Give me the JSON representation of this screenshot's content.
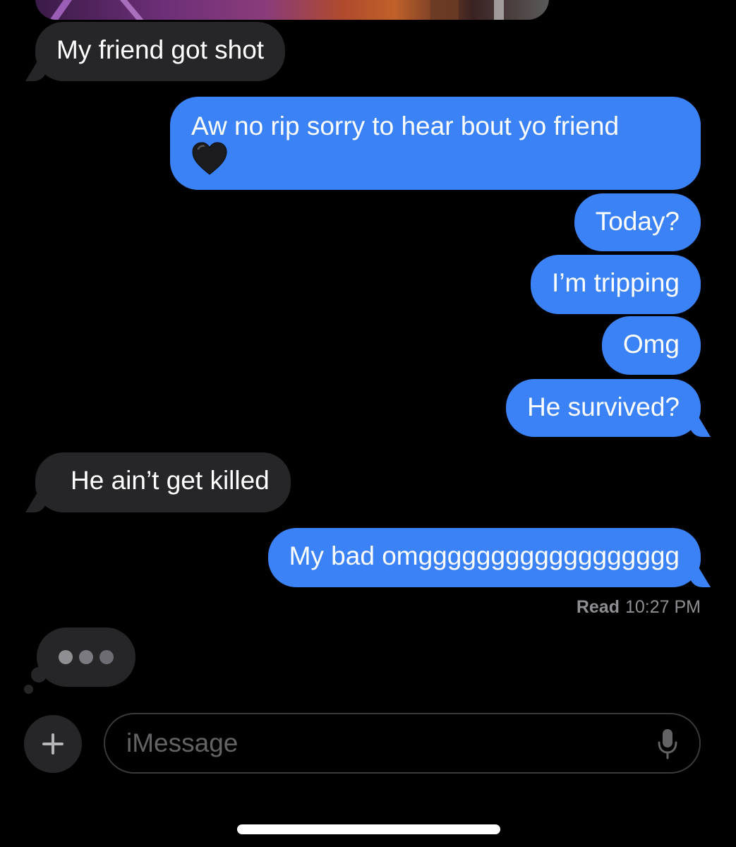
{
  "messages": [
    {
      "direction": "received",
      "text": "My friend got shot"
    },
    {
      "direction": "sent",
      "text": "Aw no rip sorry to hear bout yo friend",
      "emoji": "🖤"
    },
    {
      "direction": "sent",
      "text": "Today?"
    },
    {
      "direction": "sent",
      "text": "I’m tripping"
    },
    {
      "direction": "sent",
      "text": "Omg"
    },
    {
      "direction": "sent",
      "text": "He survived?"
    },
    {
      "direction": "received",
      "text": "He ain’t get killed"
    },
    {
      "direction": "sent",
      "text": "My bad omgggggggggggggggggg"
    }
  ],
  "receipt": {
    "status": "Read",
    "time": "10:27 PM"
  },
  "composer": {
    "placeholder": "iMessage"
  },
  "icons": {
    "add": "plus-icon",
    "mic": "microphone-icon",
    "typing": "typing-indicator"
  },
  "colors": {
    "sent_bubble": "#3b82f6",
    "received_bubble": "#262628",
    "background": "#000000"
  }
}
